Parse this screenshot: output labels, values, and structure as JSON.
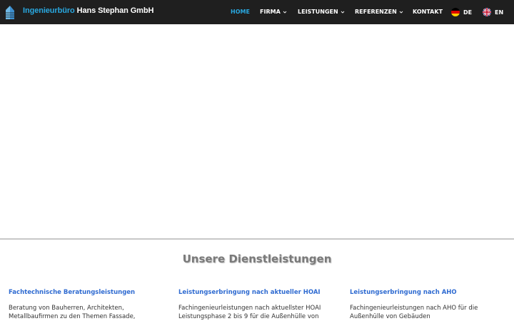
{
  "brand": {
    "part1": "Ingenieurbüro",
    "part2": " Hans Stephan GmbH",
    "accent": "#29a8e0"
  },
  "nav": {
    "home": "HOME",
    "firma": "FIRMA",
    "leistungen": "LEISTUNGEN",
    "referenzen": "REFERENZEN",
    "kontakt": "KONTAKT",
    "lang_de": "DE",
    "lang_en": "EN"
  },
  "services": {
    "title": "Unsere Dienstleistungen",
    "items": [
      {
        "heading": "Fachtechnische Beratungsleistungen",
        "text_line1": "Beratung von Bauherren, Architekten,",
        "text_line2": "Metallbaufirmen zu den Themen Fassade,"
      },
      {
        "heading": "Leistungserbringung nach aktueller HOAI",
        "text_line1": "Fachingenieurleistungen nach aktuellster HOAI",
        "text_line2": "Leistungsphase 2 bis 9 für die Außenhülle von"
      },
      {
        "heading": "Leistungserbringung nach AHO",
        "text_line1": "Fachingenieurleistungen nach AHO für die",
        "text_line2": "Außenhülle von Gebäuden"
      }
    ]
  }
}
